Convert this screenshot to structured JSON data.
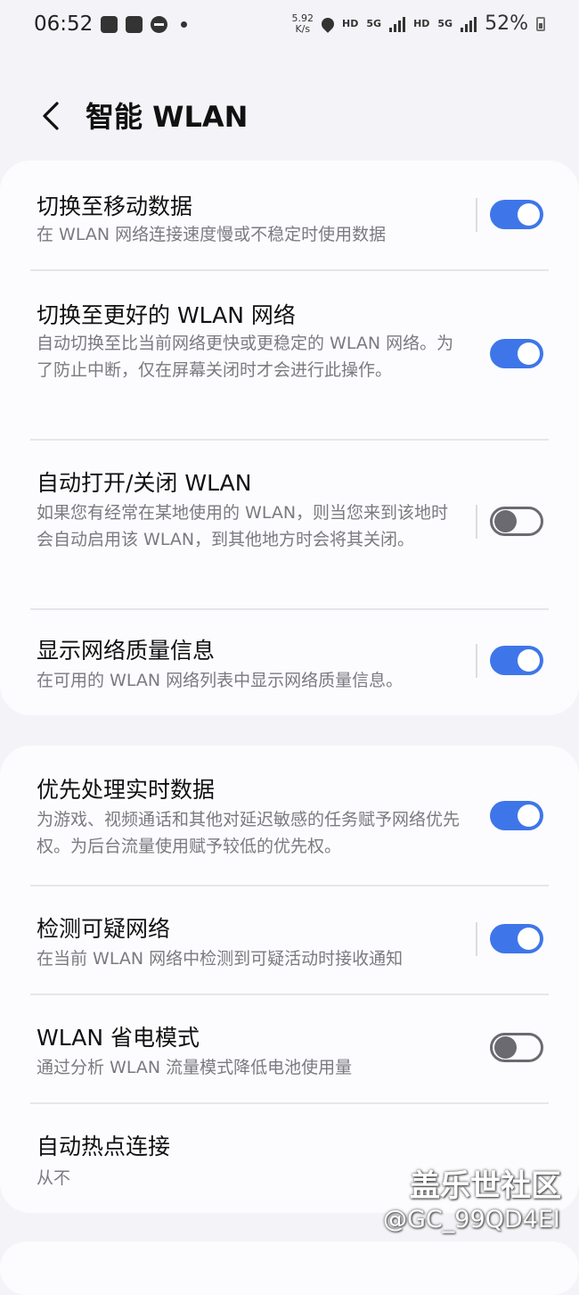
{
  "status_bar": {
    "time": "06:52",
    "speed_value": "5.92",
    "speed_unit": "K/s",
    "hd1": "HD",
    "net1": "5G",
    "hd2": "HD",
    "net2": "5G",
    "battery": "52%"
  },
  "header": {
    "title": "智能 WLAN"
  },
  "section1": [
    {
      "title": "切换至移动数据",
      "desc": "在 WLAN 网络连接速度慢或不稳定时使用数据",
      "on": true
    },
    {
      "title": "切换至更好的 WLAN 网络",
      "desc": "自动切换至比当前网络更快或更稳定的 WLAN 网络。为了防止中断，仅在屏幕关闭时才会进行此操作。",
      "on": true
    },
    {
      "title": "自动打开/关闭 WLAN",
      "desc": "如果您有经常在某地使用的 WLAN，则当您来到该地时会自动启用该 WLAN，到其他地方时会将其关闭。",
      "on": false
    },
    {
      "title": "显示网络质量信息",
      "desc": "在可用的 WLAN 网络列表中显示网络质量信息。",
      "on": true
    }
  ],
  "section2": [
    {
      "title": "优先处理实时数据",
      "desc": "为游戏、视频通话和其他对延迟敏感的任务赋予网络优先权。为后台流量使用赋予较低的优先权。",
      "on": true
    },
    {
      "title": "检测可疑网络",
      "desc": "在当前 WLAN 网络中检测到可疑活动时接收通知",
      "on": true
    },
    {
      "title": "WLAN 省电模式",
      "desc": "通过分析 WLAN 流量模式降低电池使用量",
      "on": false
    },
    {
      "title": "自动热点连接",
      "value": "从不"
    }
  ],
  "watermark": {
    "line1": "盖乐世社区",
    "line2": "@GC_99QD4EI"
  },
  "colors": {
    "accent": "#3e76ea",
    "background": "#f4f4f8",
    "card": "#fcfcfe",
    "secondary_text": "#7a7a80"
  }
}
